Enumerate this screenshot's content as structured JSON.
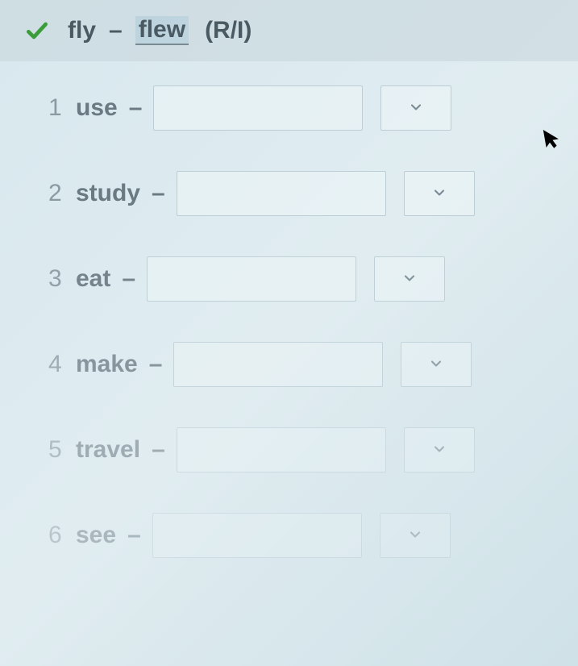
{
  "example": {
    "verb": "fly",
    "dash": "–",
    "answer": "flew",
    "hint": "(R/I)"
  },
  "questions": [
    {
      "number": "1",
      "verb": "use",
      "dash": "–",
      "value": ""
    },
    {
      "number": "2",
      "verb": "study",
      "dash": "–",
      "value": ""
    },
    {
      "number": "3",
      "verb": "eat",
      "dash": "–",
      "value": ""
    },
    {
      "number": "4",
      "verb": "make",
      "dash": "–",
      "value": ""
    },
    {
      "number": "5",
      "verb": "travel",
      "dash": "–",
      "value": ""
    },
    {
      "number": "6",
      "verb": "see",
      "dash": "–",
      "value": ""
    }
  ]
}
